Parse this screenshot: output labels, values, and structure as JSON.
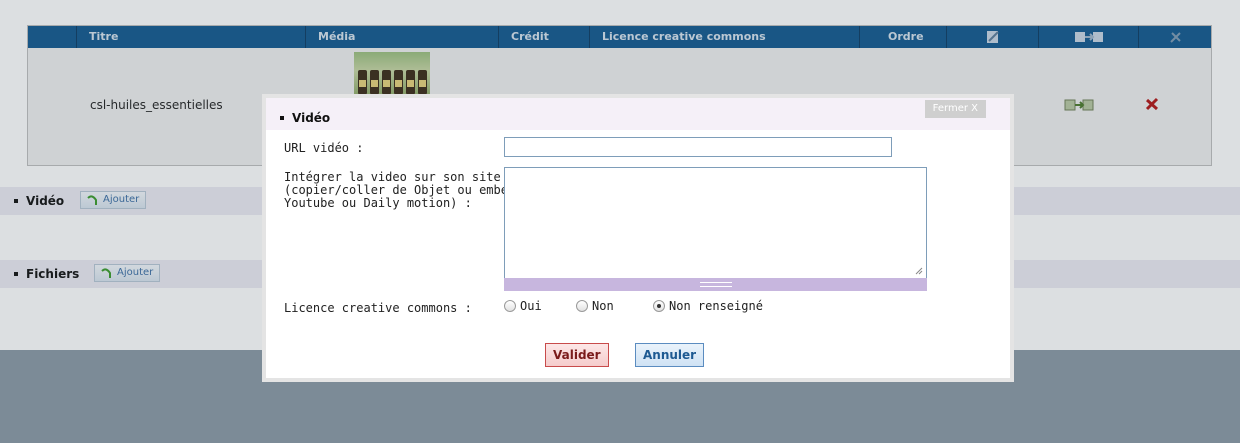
{
  "table": {
    "headers": [
      "Titre",
      "Média",
      "Crédit",
      "Licence creative commons",
      "Ordre"
    ],
    "header_icons": [
      "edit-icon",
      "move-icon",
      "tools-icon"
    ],
    "rows": [
      {
        "title": "csl-huiles_essentielles",
        "media": "thumbnail-essential-oils"
      }
    ]
  },
  "sections": {
    "video": {
      "label": "Vidéo",
      "add_label": "Ajouter"
    },
    "files": {
      "label": "Fichiers",
      "add_label": "Ajouter"
    }
  },
  "modal": {
    "title": "Vidéo",
    "close_label": "Fermer X",
    "url_label": "URL vidéo :",
    "url_value": "",
    "embed_label_lines": [
      "Intégrer la video sur son site",
      "(copier/coller de Objet ou embed",
      "Youtube ou Daily motion) :"
    ],
    "embed_value": "",
    "license_label": "Licence creative commons :",
    "license_options": [
      "Oui",
      "Non",
      "Non renseigné"
    ],
    "license_selected": "Non renseigné",
    "submit_label": "Valider",
    "cancel_label": "Annuler"
  },
  "colors": {
    "header_blue": "#12588f",
    "section_bg": "#ecebf3",
    "modal_head_bg": "#f5f0f8",
    "resize_bar": "#c7b6de"
  }
}
